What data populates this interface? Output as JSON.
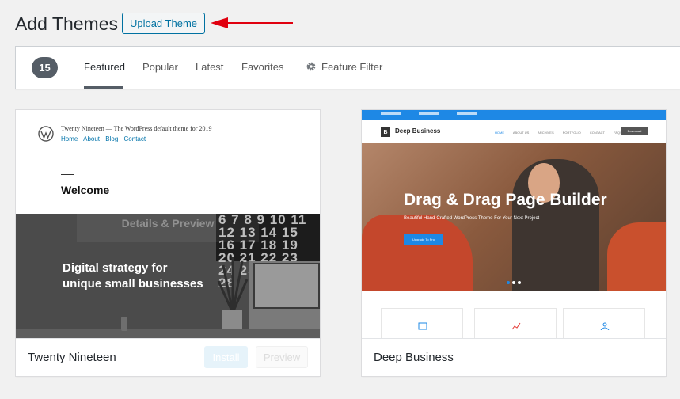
{
  "header": {
    "title": "Add Themes",
    "upload_label": "Upload Theme"
  },
  "filter_bar": {
    "count": "15",
    "tabs": [
      {
        "label": "Featured",
        "current": true
      },
      {
        "label": "Popular"
      },
      {
        "label": "Latest"
      },
      {
        "label": "Favorites"
      }
    ],
    "feature_filter_label": "Feature Filter"
  },
  "themes": [
    {
      "name": "Twenty Nineteen",
      "install_label": "Install",
      "preview_label": "Preview",
      "overlay_label": "Details & Preview",
      "screenshot": {
        "site_title": "Twenty Nineteen — The WordPress default theme for 2019",
        "nav": [
          "Home",
          "About",
          "Blog",
          "Contact"
        ],
        "welcome": "Welcome",
        "hero_line1": "Digital strategy for",
        "hero_line2": "unique small businesses",
        "calendar": "6 7 8 9 10 11 12 13 14 15 16 17 18 19 20 21 22 23 24 25 26 27 28"
      }
    },
    {
      "name": "Deep Business",
      "screenshot": {
        "logo_letter": "B",
        "logo_text": "Deep Business",
        "menu": [
          "HOME",
          "ABOUT US",
          "ARCHIVES",
          "PORTFOLIO",
          "CONTACT",
          "FAQS"
        ],
        "cta": "Download",
        "hero_title": "Drag & Drag Page Builder",
        "hero_sub": "Beautiful Hand-Crafted WordPress Theme For Your Next Project",
        "hero_button": "Upgrade To Pro"
      }
    }
  ],
  "colors": {
    "accent": "#0071a1",
    "arrow": "#e0000f",
    "count_badge": "#555d66",
    "deep_business_blue": "#1e88e5"
  }
}
